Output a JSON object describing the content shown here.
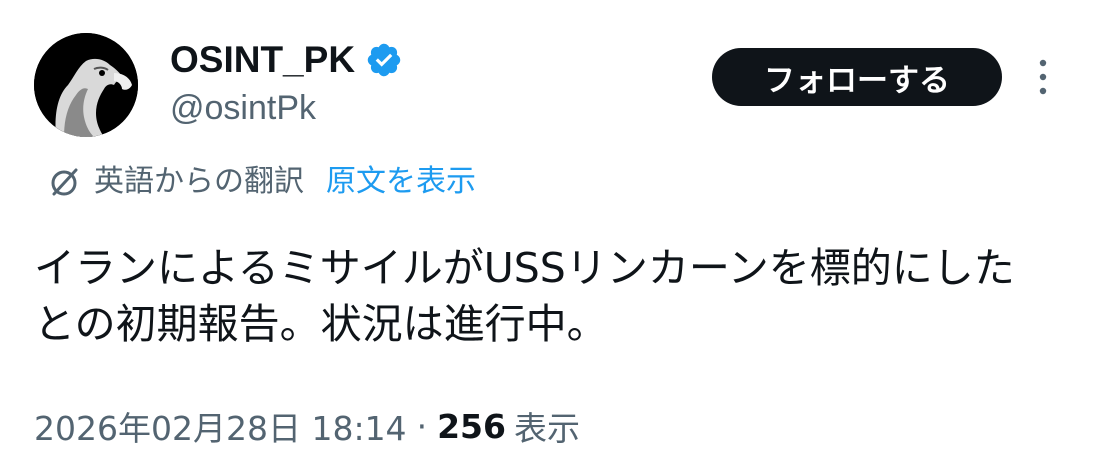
{
  "author": {
    "display_name": "OSINT_PK",
    "handle": "@osintPk",
    "verified_icon": "verified-badge-icon",
    "avatar_icon": "eagle-avatar"
  },
  "actions": {
    "follow_label": "フォローする",
    "more_icon": "more-options-icon"
  },
  "translation": {
    "icon": "translate-icon",
    "translated_from": "英語からの翻訳",
    "show_original": "原文を表示"
  },
  "tweet": {
    "text": "イランによるミサイルがUSSリンカーンを標的にしたとの初期報告。状況は進行中。"
  },
  "meta": {
    "timestamp": "2026年02月28日 18:14",
    "separator": "·",
    "view_count": "256",
    "views_label": "表示"
  },
  "colors": {
    "text_primary": "#0f1419",
    "text_secondary": "#536471",
    "link": "#1d9bf0",
    "verified": "#1d9bf0",
    "follow_bg": "#0f1419"
  }
}
